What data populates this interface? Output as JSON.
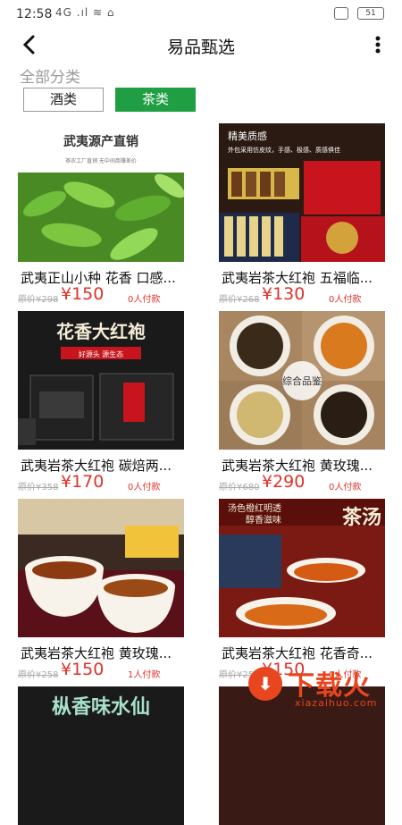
{
  "status_bar": {
    "time": "12:58",
    "signal": "4G .ıl ≋ ⌂",
    "battery": "51"
  },
  "header": {
    "title": "易品甄选"
  },
  "section": {
    "label": "全部分类"
  },
  "tabs": [
    {
      "label": "酒类",
      "active": false
    },
    {
      "label": "茶类",
      "active": true
    }
  ],
  "products": [
    {
      "name": "武夷正山小种 花香 口感...",
      "orig_price": "原价¥298",
      "price": "¥150",
      "paid": "0人付款",
      "img_text": [
        "武夷源产直销",
        "茶农工厂直销 无中间商赚差价"
      ]
    },
    {
      "name": "武夷岩茶大红袍 五福临...",
      "orig_price": "原价¥268",
      "price": "¥130",
      "paid": "0人付款",
      "img_text": [
        "精美质感",
        "外包采用仿皮纹，手感、极感、质感俱佳"
      ]
    },
    {
      "name": "武夷岩茶大红袍 碳焙两...",
      "orig_price": "原价¥358",
      "price": "¥170",
      "paid": "0人付款",
      "img_text": [
        "花香大红袍",
        "好源头 源生态"
      ]
    },
    {
      "name": "武夷岩茶大红袍 黄玫瑰...",
      "orig_price": "原价¥680",
      "price": "¥290",
      "paid": "0人付款",
      "img_text": [
        "综合品鉴"
      ]
    },
    {
      "name": "武夷岩茶大红袍 黄玫瑰...",
      "orig_price": "原价¥258",
      "price": "¥150",
      "paid": "1人付款",
      "img_text": []
    },
    {
      "name": "武夷岩茶大红袍 花香奇...",
      "orig_price": "原价¥258",
      "price": "¥150",
      "paid": "0人付款",
      "img_text": [
        "汤色橙红明透",
        "醇香滋味",
        "茶汤"
      ]
    },
    {
      "name": "",
      "orig_price": "",
      "price": "",
      "paid": "",
      "img_text": [
        "枞香味水仙"
      ]
    },
    {
      "name": "",
      "orig_price": "",
      "price": "",
      "paid": "",
      "img_text": []
    }
  ],
  "watermark": {
    "text": "下载火",
    "url": "xiazaihuo.com"
  },
  "colors": {
    "accent": "#1f9e44",
    "price": "#e0322a",
    "watermark": "#e8461f"
  }
}
